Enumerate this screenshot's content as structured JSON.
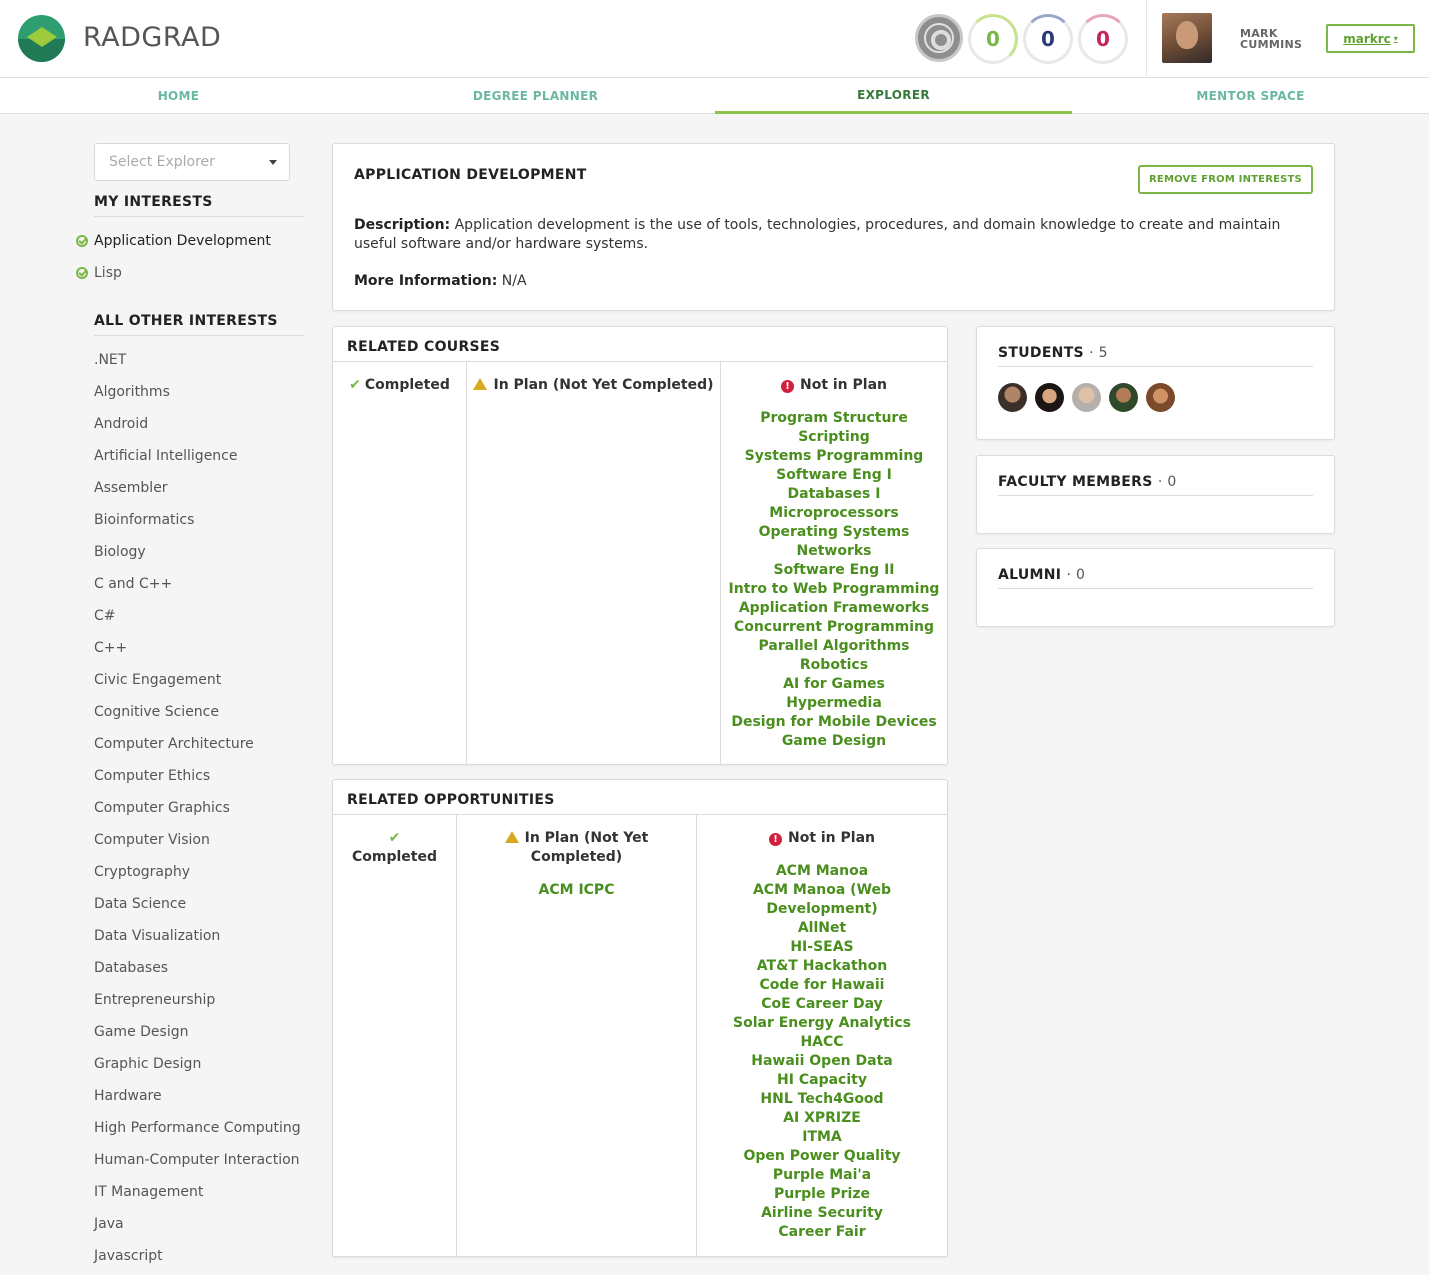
{
  "app": {
    "brand": "RADGRAD"
  },
  "header": {
    "icons": {
      "levels": "level-gear-icon"
    },
    "scores": [
      "0",
      "0",
      "0"
    ],
    "user": {
      "name_line1": "MARK",
      "name_line2": "CUMMINS",
      "menu_label": "markrc",
      "caret": "▾"
    }
  },
  "nav": {
    "tabs": [
      "HOME",
      "DEGREE PLANNER",
      "EXPLORER",
      "MENTOR SPACE"
    ],
    "active": "EXPLORER"
  },
  "sidebar": {
    "select_placeholder": "Select Explorer",
    "my_interests_title": "MY INTERESTS",
    "my_interests": [
      "Application Development",
      "Lisp"
    ],
    "all_other_title": "ALL OTHER INTERESTS",
    "other_interests": [
      ".NET",
      "Algorithms",
      "Android",
      "Artificial Intelligence",
      "Assembler",
      "Bioinformatics",
      "Biology",
      "C and C++",
      "C#",
      "C++",
      "Civic Engagement",
      "Cognitive Science",
      "Computer Architecture",
      "Computer Ethics",
      "Computer Graphics",
      "Computer Vision",
      "Cryptography",
      "Data Science",
      "Data Visualization",
      "Databases",
      "Entrepreneurship",
      "Game Design",
      "Graphic Design",
      "Hardware",
      "High Performance Computing",
      "Human-Computer Interaction",
      "IT Management",
      "Java",
      "Javascript"
    ]
  },
  "main": {
    "title": "APPLICATION DEVELOPMENT",
    "remove_button": "REMOVE FROM INTERESTS",
    "description_label": "Description:",
    "description": "Application development is the use of tools, technologies, procedures, and domain knowledge to create and maintain useful software and/or hardware systems.",
    "more_label": "More Information:",
    "more_value": "N/A"
  },
  "related_courses": {
    "title": "RELATED COURSES",
    "completed_label": "Completed",
    "inplan_label": "In Plan (Not Yet Completed)",
    "notinplan_label": "Not in Plan",
    "completed": [],
    "inplan": [],
    "notinplan": [
      "Program Structure",
      "Scripting",
      "Systems Programming",
      "Software Eng I",
      "Databases I",
      "Microprocessors",
      "Operating Systems",
      "Networks",
      "Software Eng II",
      "Intro to Web Programming",
      "Application Frameworks",
      "Concurrent Programming",
      "Parallel Algorithms",
      "Robotics",
      "AI for Games",
      "Hypermedia",
      "Design for Mobile Devices",
      "Game Design"
    ]
  },
  "related_opportunities": {
    "title": "RELATED OPPORTUNITIES",
    "completed_label": "Completed",
    "inplan_label_1": "In Plan (Not Yet",
    "inplan_label_2": "Completed)",
    "notinplan_label": "Not in Plan",
    "completed": [],
    "inplan": [
      "ACM ICPC"
    ],
    "notinplan": [
      "ACM Manoa",
      "ACM Manoa (Web",
      "Development)",
      "AllNet",
      "HI-SEAS",
      "AT&T Hackathon",
      "Code for Hawaii",
      "CoE Career Day",
      "Solar Energy Analytics",
      "HACC",
      "Hawaii Open Data",
      "HI Capacity",
      "HNL Tech4Good",
      "AI XPRIZE",
      "ITMA",
      "Open Power Quality",
      "Purple Mai'a",
      "Purple Prize",
      "Airline Security",
      "Career Fair"
    ]
  },
  "students": {
    "title": "STUDENTS",
    "count": "5"
  },
  "faculty": {
    "title": "FACULTY MEMBERS",
    "count": "0"
  },
  "alumni": {
    "title": "ALUMNI",
    "count": "0"
  },
  "colors": {
    "accent": "#7ab648",
    "link": "#4a8f1e",
    "nav_active": "#36793a",
    "nav": "#6ab7a4"
  }
}
